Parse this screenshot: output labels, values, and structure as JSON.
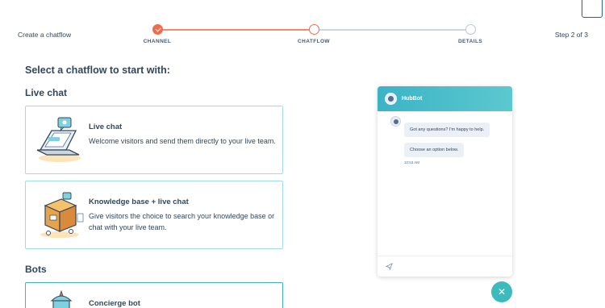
{
  "header": {
    "left_title": "Create a chatflow",
    "step_indicator": "Step 2 of 3"
  },
  "stepper": {
    "steps": [
      {
        "label": "CHANNEL",
        "state": "complete"
      },
      {
        "label": "CHATFLOW",
        "state": "current"
      },
      {
        "label": "DETAILS",
        "state": "upcoming"
      }
    ],
    "accent_color": "#f06c4c",
    "inactive_color": "#cbd6e2"
  },
  "main": {
    "heading": "Select a chatflow to start with:",
    "sections": [
      {
        "title": "Live chat",
        "cards": [
          {
            "title": "Live chat",
            "description": "Welcome visitors and send them directly to your live team.",
            "icon": "laptop-chat-illustration"
          },
          {
            "title": "Knowledge base + live chat",
            "description": "Give visitors the choice to search your knowledge base or chat with your live team.",
            "icon": "knowledge-box-illustration"
          }
        ]
      },
      {
        "title": "Bots",
        "cards": [
          {
            "title": "Concierge bot",
            "description": "",
            "icon": "concierge-bot-illustration",
            "selected": true
          }
        ]
      }
    ]
  },
  "preview": {
    "bot_name": "HubBot",
    "messages": [
      "Got any questions? I'm happy to help.",
      "Choose an option below."
    ],
    "time": "10:53 AM",
    "header_color": "#3bb4c6"
  },
  "launcher": {
    "icon": "close-icon",
    "color": "#3cbbbd"
  }
}
